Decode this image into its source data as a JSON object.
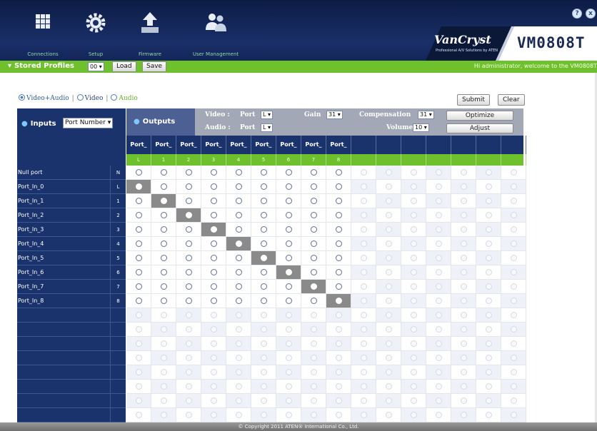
{
  "nav": {
    "items": [
      {
        "name": "nav-connections",
        "icon": "grid-icon",
        "label": "Connections"
      },
      {
        "name": "nav-setup",
        "icon": "gear-icon",
        "label": "Setup"
      },
      {
        "name": "nav-firmware",
        "icon": "upload-icon",
        "label": "Firmware"
      },
      {
        "name": "nav-user-management",
        "icon": "users-icon",
        "label": "User Management"
      }
    ],
    "help": "?",
    "logout": "x"
  },
  "brand": {
    "name": "VanCryst",
    "tagline": "Professional A/V Solutions by ATEN",
    "model": "VM0808T"
  },
  "profiles": {
    "label": "Stored Profiles",
    "selected": "00",
    "load": "Load",
    "save": "Save",
    "welcome": "Hi administrator, welcome to the VM0808T"
  },
  "modes": {
    "video_audio": "Video+Audio",
    "video": "Video",
    "audio": "Audio",
    "sep": "|",
    "selected": "video_audio"
  },
  "actions": {
    "submit": "Submit",
    "clear": "Clear"
  },
  "inputs": {
    "title": "Inputs",
    "sort": "Port Number"
  },
  "outputs": {
    "title": "Outputs",
    "video_label": "Video :",
    "audio_label": "Audio :",
    "port_label": "Port",
    "video_port": "L",
    "audio_port": "L",
    "gain_label": "Gain",
    "gain": "31",
    "comp_label": "Compensation",
    "compensation": "31",
    "volume_label": "Volume",
    "volume": "10",
    "optimize": "Optimize",
    "adjust": "Adjust"
  },
  "columns": [
    {
      "title": "Port_",
      "code": "L"
    },
    {
      "title": "Port_",
      "code": "1"
    },
    {
      "title": "Port_",
      "code": "2"
    },
    {
      "title": "Port_",
      "code": "3"
    },
    {
      "title": "Port_",
      "code": "4"
    },
    {
      "title": "Port_",
      "code": "5"
    },
    {
      "title": "Port_",
      "code": "6"
    },
    {
      "title": "Port_",
      "code": "7"
    },
    {
      "title": "Port_",
      "code": "8"
    }
  ],
  "empty_columns": 7,
  "rows": [
    {
      "label": "Null port",
      "code": "N",
      "selected": -1
    },
    {
      "label": "Port_In_0",
      "code": "L",
      "selected": 0
    },
    {
      "label": "Port_In_1",
      "code": "1",
      "selected": 1
    },
    {
      "label": "Port_In_2",
      "code": "2",
      "selected": 2
    },
    {
      "label": "Port_In_3",
      "code": "3",
      "selected": 3
    },
    {
      "label": "Port_In_4",
      "code": "4",
      "selected": 4
    },
    {
      "label": "Port_In_5",
      "code": "5",
      "selected": 5
    },
    {
      "label": "Port_In_6",
      "code": "6",
      "selected": 6
    },
    {
      "label": "Port_In_7",
      "code": "7",
      "selected": 7
    },
    {
      "label": "Port_In_8",
      "code": "8",
      "selected": 8
    }
  ],
  "empty_rows": 8,
  "footer": "© Copyright 2011 ATEN® International Co., Ltd.",
  "colors": {
    "nav_bg": "#13265a",
    "accent_green": "#6ec12c",
    "header_navy": "#1b336d",
    "selected_cell": "#8a8a8a"
  }
}
